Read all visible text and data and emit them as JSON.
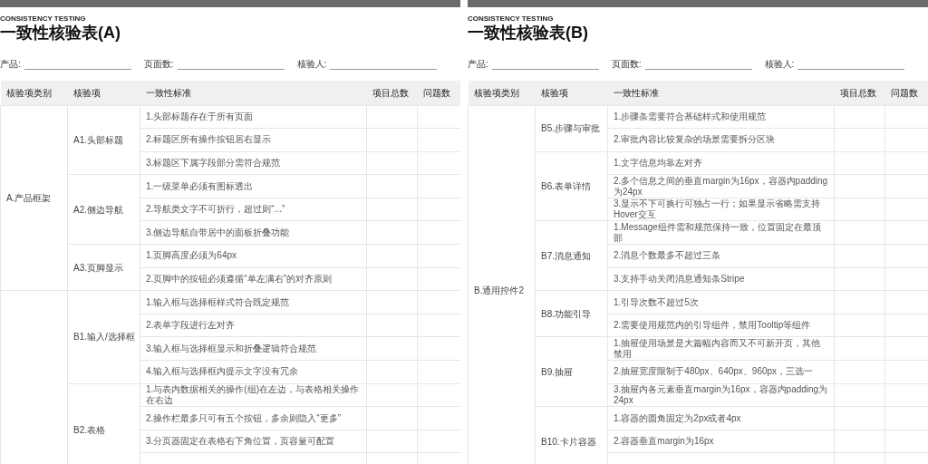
{
  "pages": [
    {
      "eyebrow": "CONSISTENCY TESTING",
      "title": "一致性核验表(A)",
      "fields": [
        {
          "label": "产品:"
        },
        {
          "label": "页面数:"
        },
        {
          "label": "核验人:"
        }
      ],
      "columns": [
        "核验项类别",
        "核验项",
        "一致性标准",
        "项目总数",
        "问题数"
      ],
      "categories": [
        {
          "name": "A.产品框架",
          "items": [
            {
              "name": "A1.头部标题",
              "criteria": [
                "1.头部标题存在于所有页面",
                "2.标题区所有操作按钮居右显示",
                "3.标题区下属字段部分需符合规范"
              ]
            },
            {
              "name": "A2.侧边导航",
              "criteria": [
                "1.一级菜单必须有图标透出",
                "2.导航类文字不可折行，超过则“...”",
                "3.侧边导航自带居中的面板折叠功能"
              ]
            },
            {
              "name": "A3.页脚显示",
              "criteria": [
                "1.页脚高度必须为64px",
                "2.页脚中的按钮必须遵循“单左满右”的对齐原则"
              ]
            }
          ]
        },
        {
          "items": [
            {
              "name": "B1.输入/选择框",
              "criteria": [
                "1.输入框与选择框样式符合既定规范",
                "2.表单字段进行左对齐",
                "3.输入框与选择框显示和折叠逻辑符合规范",
                "4.输入框与选择框内提示文字没有冗余"
              ]
            },
            {
              "name": "B2.表格",
              "criteria": [
                "1.与表内数据相关的操作(组)在左边，与表格相关操作在右边",
                "2.操作栏最多只可有五个按钮，多余则隐入“更多”",
                "3.分页器固定在表格右下角位置，页容量可配置"
              ]
            }
          ]
        }
      ]
    },
    {
      "eyebrow": "CONSISTENCY TESTING",
      "title": "一致性核验表(B)",
      "fields": [
        {
          "label": "产品:"
        },
        {
          "label": "页面数:"
        },
        {
          "label": "核验人:"
        }
      ],
      "columns": [
        "核验项类别",
        "核验项",
        "一致性标准",
        "项目总数",
        "问题数"
      ],
      "categories": [
        {
          "name": "B.通用控件2",
          "items": [
            {
              "name": "B5.步骤与审批",
              "criteria": [
                "1.步骤条需要符合基础样式和使用规范",
                "2.审批内容比较复杂的场景需要拆分区块"
              ]
            },
            {
              "name": "B6.表单详情",
              "criteria": [
                "1.文字信息均靠左对齐",
                "2.多个信息之间的垂直margin为16px，容器内padding为24px",
                "3.显示不下可换行可独占一行；如果显示省略需支持Hover交互"
              ]
            },
            {
              "name": "B7.消息通知",
              "criteria": [
                "1.Message组件需和规范保持一致，位置固定在最顶部",
                "2.消息个数最多不超过三条",
                "3.支持手动关闭消息通知条Stripe"
              ]
            },
            {
              "name": "B8.功能引导",
              "criteria": [
                "1.引导次数不超过5次",
                "2.需要使用规范内的引导组件，禁用Tooltip等组件"
              ]
            },
            {
              "name": "B9.抽屉",
              "criteria": [
                "1.抽屉使用场景是大篇幅内容而又不可新开页，其他禁用",
                "2.抽屉宽度限制于480px、640px、960px，三选一",
                "3.抽屉内各元素垂直margin为16px，容器内padding为24px"
              ]
            },
            {
              "name": "B10.卡片容器",
              "criteria": [
                "1.容器的圆角固定为2px或者4px",
                "2.容器垂直margin为16px"
              ]
            }
          ]
        }
      ]
    }
  ]
}
